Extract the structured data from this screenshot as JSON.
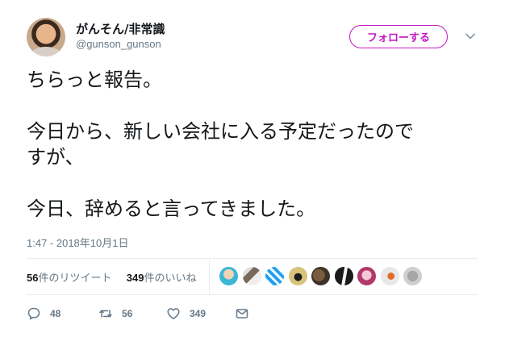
{
  "user": {
    "name": "がんそん/非常識",
    "handle": "@gunson_gunson"
  },
  "follow_label": "フォローする",
  "tweet_lines": [
    "ちらっと報告。",
    "",
    "今日から、新しい会社に入る予定だったので",
    "すが、",
    "",
    "今日、辞めると言ってきました。"
  ],
  "timestamp": "1:47 - 2018年10月1日",
  "stats": {
    "retweets_count": "56",
    "retweets_label": "件のリツイート",
    "likes_count": "349",
    "likes_label": "件のいいね"
  },
  "actions": {
    "reply_count": "48",
    "retweet_count": "56",
    "like_count": "349"
  },
  "colors": {
    "accent": "#c417c4",
    "text": "#14171a",
    "muted": "#657786",
    "divider": "#e6ecf0"
  },
  "icons": [
    "chevron-down-icon",
    "reply-icon",
    "retweet-icon",
    "like-icon",
    "direct-message-icon"
  ]
}
